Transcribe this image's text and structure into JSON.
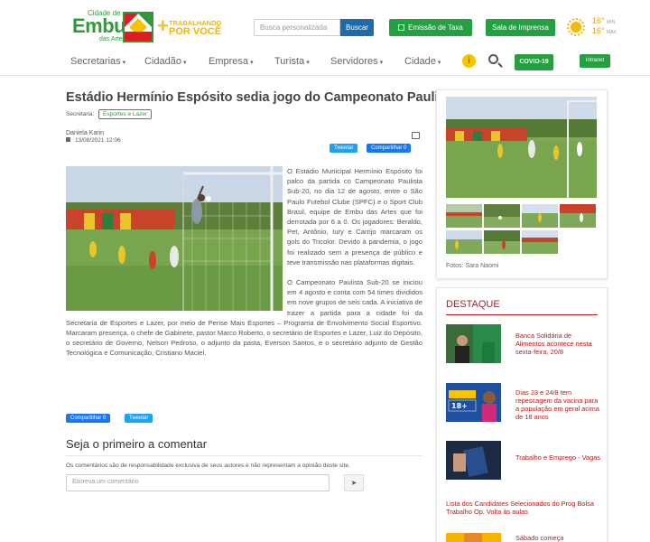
{
  "header": {
    "logo_top": "Cidade de",
    "logo_main": "Embu",
    "logo_bottom": "das Artes",
    "slogan_top": "TRABALHANDO",
    "slogan_main": "POR VOCÊ",
    "search_placeholder": "Busca personalizada",
    "search_button": "Buscar",
    "btn_taxa": "Emissão de Taxa",
    "btn_imprensa": "Sala de Imprensa",
    "temp_min": "16°",
    "temp_min_label": "MIN",
    "temp_max": "16°",
    "temp_max_label": "MAX",
    "btn_covid": "COVID-19",
    "btn_intranet": "Intranet",
    "colors": {
      "green": "#24a043",
      "blue": "#1f6aa7",
      "red": "#b01c1c",
      "yellow": "#f6c400"
    }
  },
  "nav": {
    "items": [
      {
        "label": "Secretarias"
      },
      {
        "label": "Cidadão"
      },
      {
        "label": "Empresa"
      },
      {
        "label": "Turista"
      },
      {
        "label": "Servidores"
      },
      {
        "label": "Cidade"
      }
    ]
  },
  "article": {
    "title": "Estádio Hermínio Espósito sedia jogo do Campeonato Paulista Sub-20",
    "section_label": "Secretaria:",
    "section_tag": "Esportes e Lazer",
    "author": "Daniela Karin",
    "date": "13/08/2021 12:06",
    "share_twitter": "Tweetar",
    "share_facebook": "Compartilhar 0",
    "paragraphs": [
      "O Estádio Municipal Hermínio Espósito foi palco da partida co Campeonato Paulista Sub-20, no dia 12 de agosto, entre o São Paulo Futebol Clube (SPFC) e o Sport Club Brasil, equipe de Embu das Artes que foi derrotada por 6 a 0. Os jogadores: Beraldo, Pet, Antônio, Iury e Carrijo marcaram os gols do Tricolor. Devido à pandemia, o jogo foi realizado sem a presença de público e teve transmissão nas plataformas digitais.",
      "O Campeonato Paulista Sub-20 se iniciou em 4 agosto e conta com 54 times divididos em nove grupos de seis cada. A iniciativa de trazer a partida para a cidade foi da Secretaria de Esportes e Lazer, por meio de Pense Mais Esportes – Programa de Envolvimento Social Esportivo. Marcaram presença, o chefe de Gabinete, pastor Marco Roberto, o secretário de Esportes e Lazer, Luiz do Depósito, o secretário de Governo, Nelson Pedroso, o adjunto da pasta, Everson Santos, e o secretário adjunto de Gestão Tecnológica e Comunicação, Cristiano Maciel."
    ],
    "share_facebook_bottom": "Compartilhar 0",
    "share_twitter_bottom": "Tweetar"
  },
  "comments": {
    "title": "Seja o primeiro a comentar",
    "note": "Os comentários são de responsabilidade exclusiva de seus autores e não representam a opinião deste site.",
    "placeholder": "Escreva um comentário",
    "send_icon": "paper-plane-icon"
  },
  "sidebar": {
    "photo_credit": "Fotos: Sara Naomi",
    "destaque_title": "DESTAQUE",
    "news": [
      {
        "title": "Banca Solidária de Alimentos acontece nesta sexta-feira, 20/8"
      },
      {
        "title": "Dias 23 e 24/8 tem repescagem da vacina para a população em geral acima de 18 anos"
      },
      {
        "title": "Trabalho e Emprego - Vagas"
      },
      {
        "title": "Lista dos Candidates Selecionados do Prog Bolsa Trabalho Op. Volta às aulas"
      },
      {
        "title": "Sábado começa"
      }
    ]
  }
}
